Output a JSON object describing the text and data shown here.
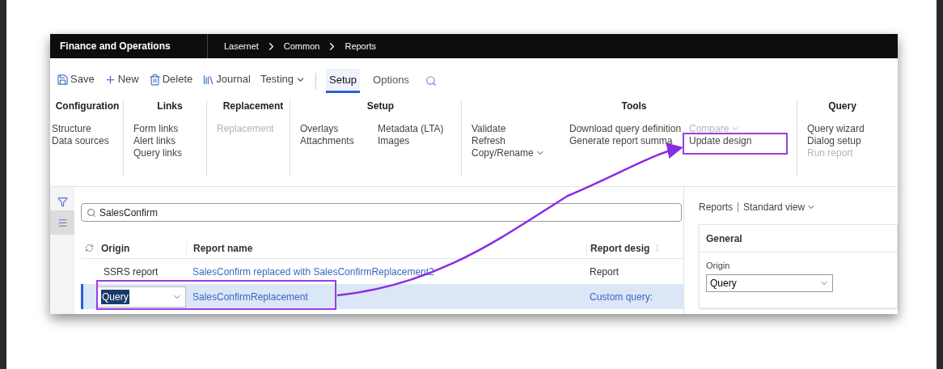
{
  "header": {
    "app_name": "Finance and Operations",
    "breadcrumb": [
      "Lasernet",
      "Common",
      "Reports"
    ]
  },
  "toolbar": [
    {
      "label": "Save",
      "kind": "save"
    },
    {
      "label": "New",
      "kind": "new"
    },
    {
      "label": "Delete",
      "kind": "delete"
    },
    {
      "label": "Journal",
      "kind": "journal"
    },
    {
      "label": "Testing",
      "kind": "menu"
    },
    {
      "label": "Setup",
      "kind": "tab",
      "selected": true
    },
    {
      "label": "Options",
      "kind": "tab",
      "selected": false
    }
  ],
  "ribbon": [
    {
      "title": "Configuration",
      "columns": [
        [
          {
            "label": "Structure",
            "disabled": false
          },
          {
            "label": "Data sources",
            "disabled": false
          }
        ]
      ]
    },
    {
      "title": "Links",
      "columns": [
        [
          {
            "label": "Form links",
            "disabled": false
          },
          {
            "label": "Alert links",
            "disabled": false
          },
          {
            "label": "Query links",
            "disabled": false
          }
        ]
      ]
    },
    {
      "title": "Replacement",
      "columns": [
        [
          {
            "label": "Replacement",
            "disabled": true
          }
        ]
      ]
    },
    {
      "title": "Setup",
      "columns": [
        [
          {
            "label": "Overlays",
            "disabled": false
          },
          {
            "label": "Attachments",
            "disabled": false
          }
        ],
        [
          {
            "label": "Metadata (LTA)",
            "disabled": false
          },
          {
            "label": "Images",
            "disabled": false
          }
        ]
      ]
    },
    {
      "title": "Tools",
      "columns": [
        [
          {
            "label": "Validate",
            "disabled": false
          },
          {
            "label": "Refresh",
            "disabled": false
          },
          {
            "label": "Copy/Rename",
            "disabled": false,
            "menu": true
          }
        ],
        [
          {
            "label": "Download query definition",
            "disabled": false
          },
          {
            "label": "Generate report summa",
            "disabled": false
          }
        ],
        [
          {
            "label": "Compare",
            "disabled": true,
            "menu": true
          },
          {
            "label": "Update design",
            "disabled": false
          }
        ]
      ]
    },
    {
      "title": "Query",
      "columns": [
        [
          {
            "label": "Query wizard",
            "disabled": false
          },
          {
            "label": "Dialog setup",
            "disabled": false
          },
          {
            "label": "Run report",
            "disabled": true
          }
        ]
      ]
    }
  ],
  "filter": {
    "value": "SalesConfirm"
  },
  "grid": {
    "columns": [
      "Origin",
      "Report name",
      "Report desig"
    ],
    "rows": [
      {
        "origin": "SSRS report",
        "report_name": "SalesConfirm replaced with SalesConfirmReplacement2",
        "report_design": "Report",
        "selected": false
      },
      {
        "origin": "Query",
        "report_name": "SalesConfirmReplacement",
        "report_design": "Custom query:",
        "selected": true
      }
    ]
  },
  "details": {
    "title": "Reports",
    "view": "Standard view",
    "section": "General",
    "field_label": "Origin",
    "field_value": "Query"
  }
}
